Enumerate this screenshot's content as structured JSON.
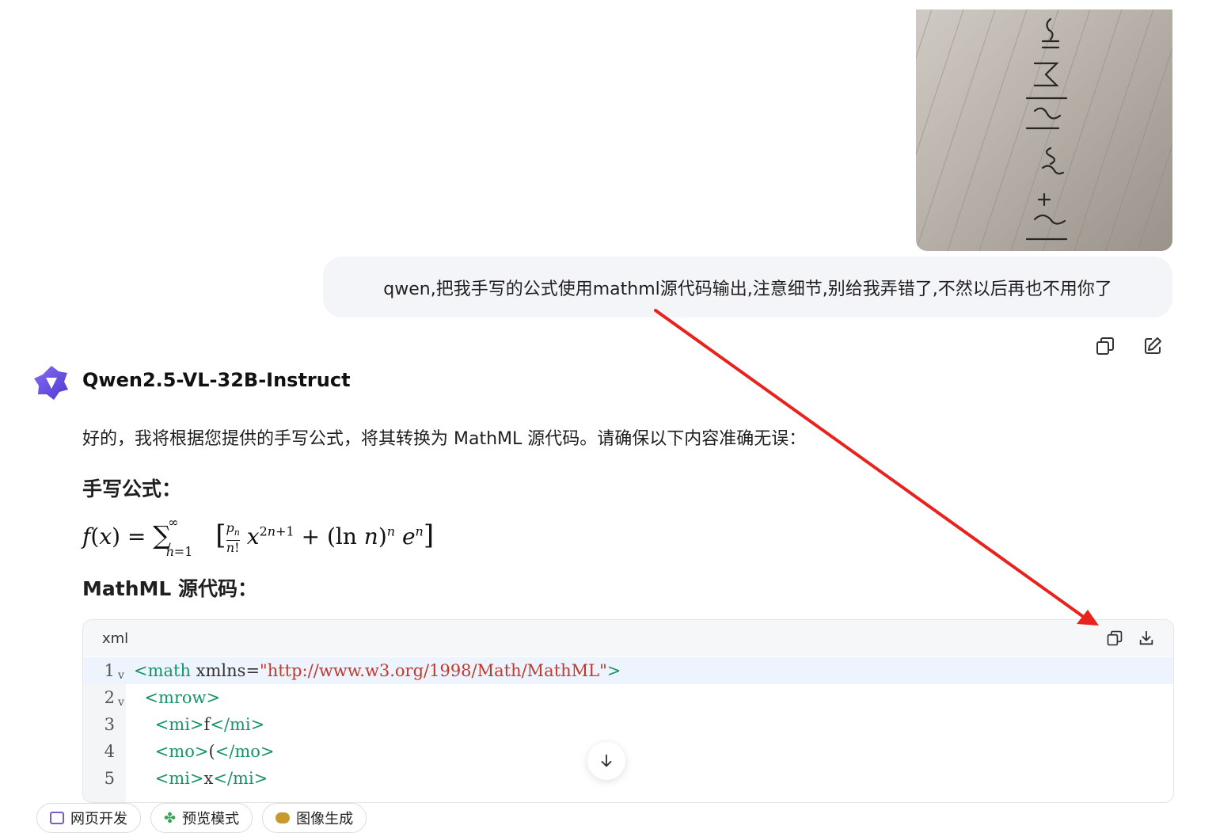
{
  "user_message": {
    "text": "qwen,把我手写的公式使用mathml源代码输出,注意细节,别给我弄错了,不然以后再也不用你了",
    "action_icons": [
      "copy-icon",
      "edit-icon"
    ]
  },
  "assistant": {
    "model_name": "Qwen2.5-VL-32B-Instruct",
    "intro": "好的，我将根据您提供的手写公式，将其转换为 MathML 源代码。请确保以下内容准确无误：",
    "heading_handwritten": "手写公式：",
    "heading_mathml": "MathML 源代码："
  },
  "code_block": {
    "language": "xml",
    "header_icons": [
      "copy-icon",
      "download-icon"
    ],
    "lines": [
      {
        "number": "1",
        "fold": "v",
        "segments": [
          {
            "t": "tag",
            "v": "<math"
          },
          {
            "t": "attr",
            "v": " xmlns="
          },
          {
            "t": "str",
            "v": "\"http://www.w3.org/1998/Math/MathML\""
          },
          {
            "t": "tag",
            "v": ">"
          }
        ]
      },
      {
        "number": "2",
        "fold": "v",
        "segments": [
          {
            "t": "attr",
            "v": "  "
          },
          {
            "t": "tag",
            "v": "<mrow>"
          }
        ]
      },
      {
        "number": "3",
        "fold": "",
        "segments": [
          {
            "t": "attr",
            "v": "    "
          },
          {
            "t": "tag",
            "v": "<mi>"
          },
          {
            "t": "attr",
            "v": "f"
          },
          {
            "t": "tag",
            "v": "</mi>"
          }
        ]
      },
      {
        "number": "4",
        "fold": "",
        "segments": [
          {
            "t": "attr",
            "v": "    "
          },
          {
            "t": "tag",
            "v": "<mo>"
          },
          {
            "t": "attr",
            "v": "("
          },
          {
            "t": "tag",
            "v": "</mo>"
          }
        ]
      },
      {
        "number": "5",
        "fold": "",
        "segments": [
          {
            "t": "attr",
            "v": "    "
          },
          {
            "t": "tag",
            "v": "<mi>"
          },
          {
            "t": "attr",
            "v": "x"
          },
          {
            "t": "tag",
            "v": "</mi>"
          }
        ]
      }
    ]
  },
  "bottom_chips": [
    {
      "label": "网页开发",
      "icon": "web-icon"
    },
    {
      "label": "预览模式",
      "icon": "clover-icon"
    },
    {
      "label": "图像生成",
      "icon": "image-icon"
    }
  ],
  "colors": {
    "annotation_arrow": "#e8231e",
    "code_tag": "#16936a",
    "code_string": "#c0392b"
  }
}
